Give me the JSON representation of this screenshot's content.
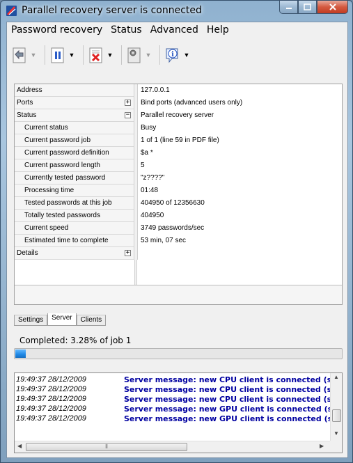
{
  "window": {
    "title": "Parallel recovery server is connected",
    "caption_buttons": [
      "minimize-icon",
      "maximize-icon",
      "close-icon"
    ],
    "accent": "#c13b22"
  },
  "menu": [
    "Password recovery",
    "Status",
    "Advanced",
    "Help"
  ],
  "toolbar": {
    "buttons": [
      {
        "icon": "back-arrow-icon",
        "has_dropdown": true,
        "dropdown_enabled": false
      },
      {
        "icon": "pause-icon",
        "has_dropdown": true,
        "dropdown_enabled": true
      },
      {
        "icon": "stop-document-icon",
        "has_dropdown": true,
        "dropdown_enabled": true
      },
      {
        "icon": "settings-gear-icon",
        "has_dropdown": true,
        "dropdown_enabled": false
      },
      {
        "icon": "info-icon",
        "has_dropdown": true,
        "dropdown_enabled": true
      }
    ]
  },
  "properties": {
    "rows": [
      {
        "name": "Address",
        "value": "127.0.0.1",
        "level": 0,
        "expander": ""
      },
      {
        "name": "Ports",
        "value": "Bind ports (advanced users only)",
        "level": 0,
        "expander": "+"
      },
      {
        "name": "Status",
        "value": "Parallel recovery server",
        "level": 0,
        "expander": "−"
      },
      {
        "name": "Current status",
        "value": "Busy",
        "level": 1,
        "expander": ""
      },
      {
        "name": "Current password job",
        "value": "1 of 1 (line 59 in PDF file)",
        "level": 1,
        "expander": ""
      },
      {
        "name": "Current password definition",
        "value": "$a *",
        "level": 1,
        "expander": ""
      },
      {
        "name": "Current password length",
        "value": "5",
        "level": 1,
        "expander": ""
      },
      {
        "name": "Currently tested password",
        "value": "\"z????\"",
        "level": 1,
        "expander": ""
      },
      {
        "name": "Processing time",
        "value": "01:48",
        "level": 1,
        "expander": ""
      },
      {
        "name": "Tested passwords at this job",
        "value": "404950 of 12356630",
        "level": 1,
        "expander": ""
      },
      {
        "name": "Totally tested passwords",
        "value": "404950",
        "level": 1,
        "expander": ""
      },
      {
        "name": "Current speed",
        "value": "3749 passwords/sec",
        "level": 1,
        "expander": ""
      },
      {
        "name": "Estimated time to complete",
        "value": "53 min, 07 sec",
        "level": 1,
        "expander": ""
      },
      {
        "name": "Details",
        "value": "",
        "level": 0,
        "expander": "+"
      }
    ]
  },
  "tabs": {
    "items": [
      "Settings",
      "Server",
      "Clients"
    ],
    "active": "Server"
  },
  "progress": {
    "label": "Completed: 3.28% of job 1",
    "percent": 3.28,
    "color": "#1e88e5"
  },
  "log": {
    "entries": [
      {
        "time": "19:49:37 28/12/2009",
        "message": "Server message: new CPU client is connected (sessio"
      },
      {
        "time": "19:49:37 28/12/2009",
        "message": "Server message: new CPU client is connected (sessio"
      },
      {
        "time": "19:49:37 28/12/2009",
        "message": "Server message: new CPU client is connected (sessio"
      },
      {
        "time": "19:49:37 28/12/2009",
        "message": "Server message: new GPU client is connected (sessio"
      },
      {
        "time": "19:49:37 28/12/2009",
        "message": "Server message: new GPU client is connected (sessio"
      }
    ],
    "message_color": "#0000a0"
  }
}
